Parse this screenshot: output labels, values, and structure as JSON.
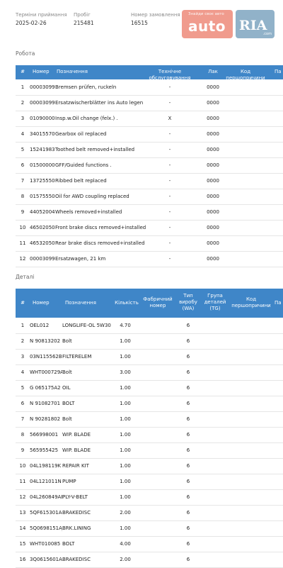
{
  "header": {
    "date_label": "Терміни приймання",
    "date_value": "2025-02-26",
    "mileage_label": "Пробіг",
    "mileage_value": "215481",
    "order_label": "Номер замовлення",
    "order_value": "16515",
    "logo_auto_small": "Знайди своє авто",
    "logo_auto": "auto",
    "logo_ria": "RIA",
    "logo_ria_domain": ".com"
  },
  "work": {
    "title": "Робота",
    "columns": [
      "#",
      "Номер",
      "Позначення",
      "Технічне обслуговування",
      "Лак",
      "Код першопричини",
      "Па"
    ],
    "rows": [
      {
        "n": "1",
        "num": "00003099",
        "name": "Bremsen prüfen, ruckeln",
        "service": "-",
        "lak": "0000"
      },
      {
        "n": "2",
        "num": "00003099",
        "name": "Ersatzwischerblätter ins Auto legen",
        "service": "-",
        "lak": "0000"
      },
      {
        "n": "3",
        "num": "01090000",
        "name": "Insp.w.Oil change (felx.) .",
        "service": "X",
        "lak": "0000"
      },
      {
        "n": "4",
        "num": "34015570",
        "name": "Gearbox oil replaced",
        "service": "-",
        "lak": "0000"
      },
      {
        "n": "5",
        "num": "15241983",
        "name": "Toothed belt removed+installed",
        "service": "-",
        "lak": "0000"
      },
      {
        "n": "6",
        "num": "01500000",
        "name": "GFF/Guided functions .",
        "service": "-",
        "lak": "0000"
      },
      {
        "n": "7",
        "num": "13725550",
        "name": "Ribbed belt replaced",
        "service": "-",
        "lak": "0000"
      },
      {
        "n": "8",
        "num": "01575550",
        "name": "Oil for AWD coupling replaced",
        "service": "-",
        "lak": "0000"
      },
      {
        "n": "9",
        "num": "44052004",
        "name": "Wheels removed+installed",
        "service": "-",
        "lak": "0000"
      },
      {
        "n": "10",
        "num": "46502050",
        "name": "Front brake discs removed+installed",
        "service": "-",
        "lak": "0000"
      },
      {
        "n": "11",
        "num": "46532050",
        "name": "Rear brake discs removed+installed",
        "service": "-",
        "lak": "0000"
      },
      {
        "n": "12",
        "num": "00003099",
        "name": "Ersatzwagen, 21 km",
        "service": "-",
        "lak": "0000"
      }
    ]
  },
  "parts": {
    "title": "Деталі",
    "columns": {
      "n": "#",
      "num": "Номер",
      "name": "Позначення",
      "qty": "Кількість",
      "factory": "Фабричний номер",
      "type": "Тип виробу (WA)",
      "group": "Група деталей (TG)",
      "code": "Код першопричини",
      "pa": "Па"
    },
    "rows": [
      {
        "n": "1",
        "num": "OEL012",
        "name": "LONGLIFE-OL 5W30",
        "qty": "4.70",
        "type": "6"
      },
      {
        "n": "2",
        "num": "N 90813202",
        "name": "Bolt",
        "qty": "1.00",
        "type": "6"
      },
      {
        "n": "3",
        "num": "03N115562B",
        "name": "FILTERELEM",
        "qty": "1.00",
        "type": "6"
      },
      {
        "n": "4",
        "num": "WHT000729A",
        "name": "Bolt",
        "qty": "3.00",
        "type": "6"
      },
      {
        "n": "5",
        "num": "G 065175A2",
        "name": "OIL",
        "qty": "1.00",
        "type": "6"
      },
      {
        "n": "6",
        "num": "N 91082701",
        "name": "BOLT",
        "qty": "1.00",
        "type": "6"
      },
      {
        "n": "7",
        "num": "N 90281802",
        "name": "Bolt",
        "qty": "1.00",
        "type": "6"
      },
      {
        "n": "8",
        "num": "566998001",
        "name": "WIP. BLADE",
        "qty": "1.00",
        "type": "6"
      },
      {
        "n": "9",
        "num": "565955425",
        "name": "WIP. BLADE",
        "qty": "1.00",
        "type": "6"
      },
      {
        "n": "10",
        "num": "04L198119K",
        "name": "REPAIR KIT",
        "qty": "1.00",
        "type": "6"
      },
      {
        "n": "11",
        "num": "04L121011N",
        "name": "PUMP",
        "qty": "1.00",
        "type": "6"
      },
      {
        "n": "12",
        "num": "04L260849AB",
        "name": "PLY-V-BELT",
        "qty": "1.00",
        "type": "6"
      },
      {
        "n": "13",
        "num": "5QF615301A",
        "name": "BRAKEDISC",
        "qty": "2.00",
        "type": "6"
      },
      {
        "n": "14",
        "num": "5Q0698151AJ",
        "name": "BRK.LINING",
        "qty": "1.00",
        "type": "6"
      },
      {
        "n": "15",
        "num": "WHT010085",
        "name": "BOLT",
        "qty": "4.00",
        "type": "6"
      },
      {
        "n": "16",
        "num": "3Q0615601A",
        "name": "BRAKEDISC",
        "qty": "2.00",
        "type": "6"
      }
    ]
  }
}
